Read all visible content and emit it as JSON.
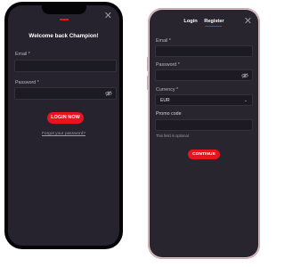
{
  "login_screen": {
    "title": "Welcome back Champion!",
    "email_label": "Email *",
    "password_label": "Password *",
    "login_button": "LOGIN NOW",
    "forgot_link": "Forgot your password?"
  },
  "register_screen": {
    "tabs": [
      "Login",
      "Register"
    ],
    "active_tab": "Register",
    "email_label": "Email *",
    "password_label": "Password *",
    "currency_label": "Currency *",
    "currency_value": "EUR",
    "promo_label": "Promo code",
    "promo_note": "This field is optional",
    "continue_button": "CONTINUE"
  },
  "colors": {
    "accent": "#e5141f",
    "screen_bg": "#26232f",
    "field_bg": "#1c1a23"
  },
  "icons": [
    "close-icon",
    "eye-off-icon",
    "chevron-down-icon"
  ]
}
